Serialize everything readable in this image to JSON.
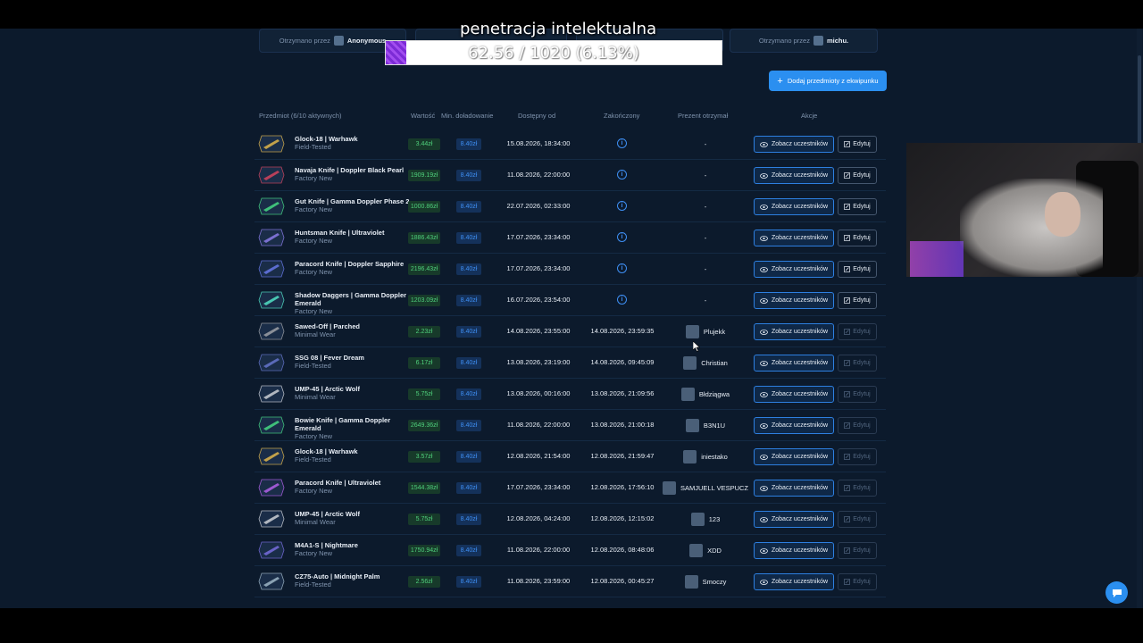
{
  "gift_cards": [
    {
      "label": "Otrzymano przez",
      "user": "Anonymous"
    },
    {
      "label": "Otrzymano przez",
      "user": "michu."
    }
  ],
  "add_button": {
    "label": "Dodaj przedmioty z ekwipunku"
  },
  "table": {
    "headers": {
      "item": "Przedmiot (6/10 aktywnych)",
      "value": "Wartość",
      "min_deposit": "Min. doładowanie",
      "available_from": "Dostępny od",
      "ended": "Zakończony",
      "gift_received": "Prezent otrzymał",
      "actions": "Akcje"
    },
    "view_label": "Zobacz uczestników",
    "edit_label": "Edytuj",
    "rows": [
      {
        "name": "Glock-18 | Warhawk",
        "wear": "Field-Tested",
        "value": "3.44zł",
        "min": "8.40zł",
        "available": "15.08.2026, 18:34:00",
        "ended": "",
        "winner": "-",
        "active": true
      },
      {
        "name": "Navaja Knife | Doppler Black Pearl",
        "wear": "Factory New",
        "value": "1909.19zł",
        "min": "8.40zł",
        "available": "11.08.2026, 22:00:00",
        "ended": "",
        "winner": "-",
        "active": true
      },
      {
        "name": "Gut Knife | Gamma Doppler Phase 2",
        "wear": "Factory New",
        "value": "1000.86zł",
        "min": "8.40zł",
        "available": "22.07.2026, 02:33:00",
        "ended": "",
        "winner": "-",
        "active": true
      },
      {
        "name": "Huntsman Knife | Ultraviolet",
        "wear": "Factory New",
        "value": "1886.43zł",
        "min": "8.40zł",
        "available": "17.07.2026, 23:34:00",
        "ended": "",
        "winner": "-",
        "active": true
      },
      {
        "name": "Paracord Knife | Doppler Sapphire",
        "wear": "Factory New",
        "value": "2196.43zł",
        "min": "8.40zł",
        "available": "17.07.2026, 23:34:00",
        "ended": "",
        "winner": "-",
        "active": true
      },
      {
        "name": "Shadow Daggers | Gamma Doppler Emerald",
        "wear": "Factory New",
        "value": "1203.09zł",
        "min": "8.40zł",
        "available": "16.07.2026, 23:54:00",
        "ended": "",
        "winner": "-",
        "active": true
      },
      {
        "name": "Sawed-Off | Parched",
        "wear": "Minimal Wear",
        "value": "2.23zł",
        "min": "8.40zł",
        "available": "14.08.2026, 23:55:00",
        "ended": "14.08.2026, 23:59:35",
        "winner": "Plujekk",
        "active": false
      },
      {
        "name": "SSG 08 | Fever Dream",
        "wear": "Field-Tested",
        "value": "6.17zł",
        "min": "8.40zł",
        "available": "13.08.2026, 23:19:00",
        "ended": "14.08.2026, 09:45:09",
        "winner": "Christian",
        "active": false
      },
      {
        "name": "UMP-45 | Arctic Wolf",
        "wear": "Minimal Wear",
        "value": "5.75zł",
        "min": "8.40zł",
        "available": "13.08.2026, 00:16:00",
        "ended": "13.08.2026, 21:09:56",
        "winner": "Błdziągwa",
        "active": false
      },
      {
        "name": "Bowie Knife | Gamma Doppler Emerald",
        "wear": "Factory New",
        "value": "2649.36zł",
        "min": "8.40zł",
        "available": "11.08.2026, 22:00:00",
        "ended": "13.08.2026, 21:00:18",
        "winner": "B3N1U",
        "active": false
      },
      {
        "name": "Glock-18 | Warhawk",
        "wear": "Field-Tested",
        "value": "3.57zł",
        "min": "8.40zł",
        "available": "12.08.2026, 21:54:00",
        "ended": "12.08.2026, 21:59:47",
        "winner": "iniestako",
        "active": false
      },
      {
        "name": "Paracord Knife | Ultraviolet",
        "wear": "Factory New",
        "value": "1544.38zł",
        "min": "8.40zł",
        "available": "17.07.2026, 23:34:00",
        "ended": "12.08.2026, 17:56:10",
        "winner": "SAMJUELL VESPUCZ",
        "active": false
      },
      {
        "name": "UMP-45 | Arctic Wolf",
        "wear": "Minimal Wear",
        "value": "5.75zł",
        "min": "8.40zł",
        "available": "12.08.2026, 04:24:00",
        "ended": "12.08.2026, 12:15:02",
        "winner": "123",
        "active": false
      },
      {
        "name": "M4A1-S | Nightmare",
        "wear": "Factory New",
        "value": "1750.94zł",
        "min": "8.40zł",
        "available": "11.08.2026, 22:00:00",
        "ended": "12.08.2026, 08:48:06",
        "winner": "XDD",
        "active": false
      },
      {
        "name": "CZ75-Auto | Midnight Palm",
        "wear": "Field-Tested",
        "value": "2.56zł",
        "min": "8.40zł",
        "available": "11.08.2026, 23:59:00",
        "ended": "12.08.2026, 00:45:27",
        "winner": "Smoczy",
        "active": false
      }
    ]
  },
  "overlay": {
    "title": "penetracja intelektualna",
    "progress_text": "62.56 / 1020 (6.13%)",
    "progress_fraction": 0.0613
  },
  "colors": {
    "background": "#0c1a2c",
    "accent": "#2b8ff0",
    "value_green": "#4fd07c",
    "min_blue": "#3e8ef2",
    "progress_purple": "#8b35e0"
  }
}
